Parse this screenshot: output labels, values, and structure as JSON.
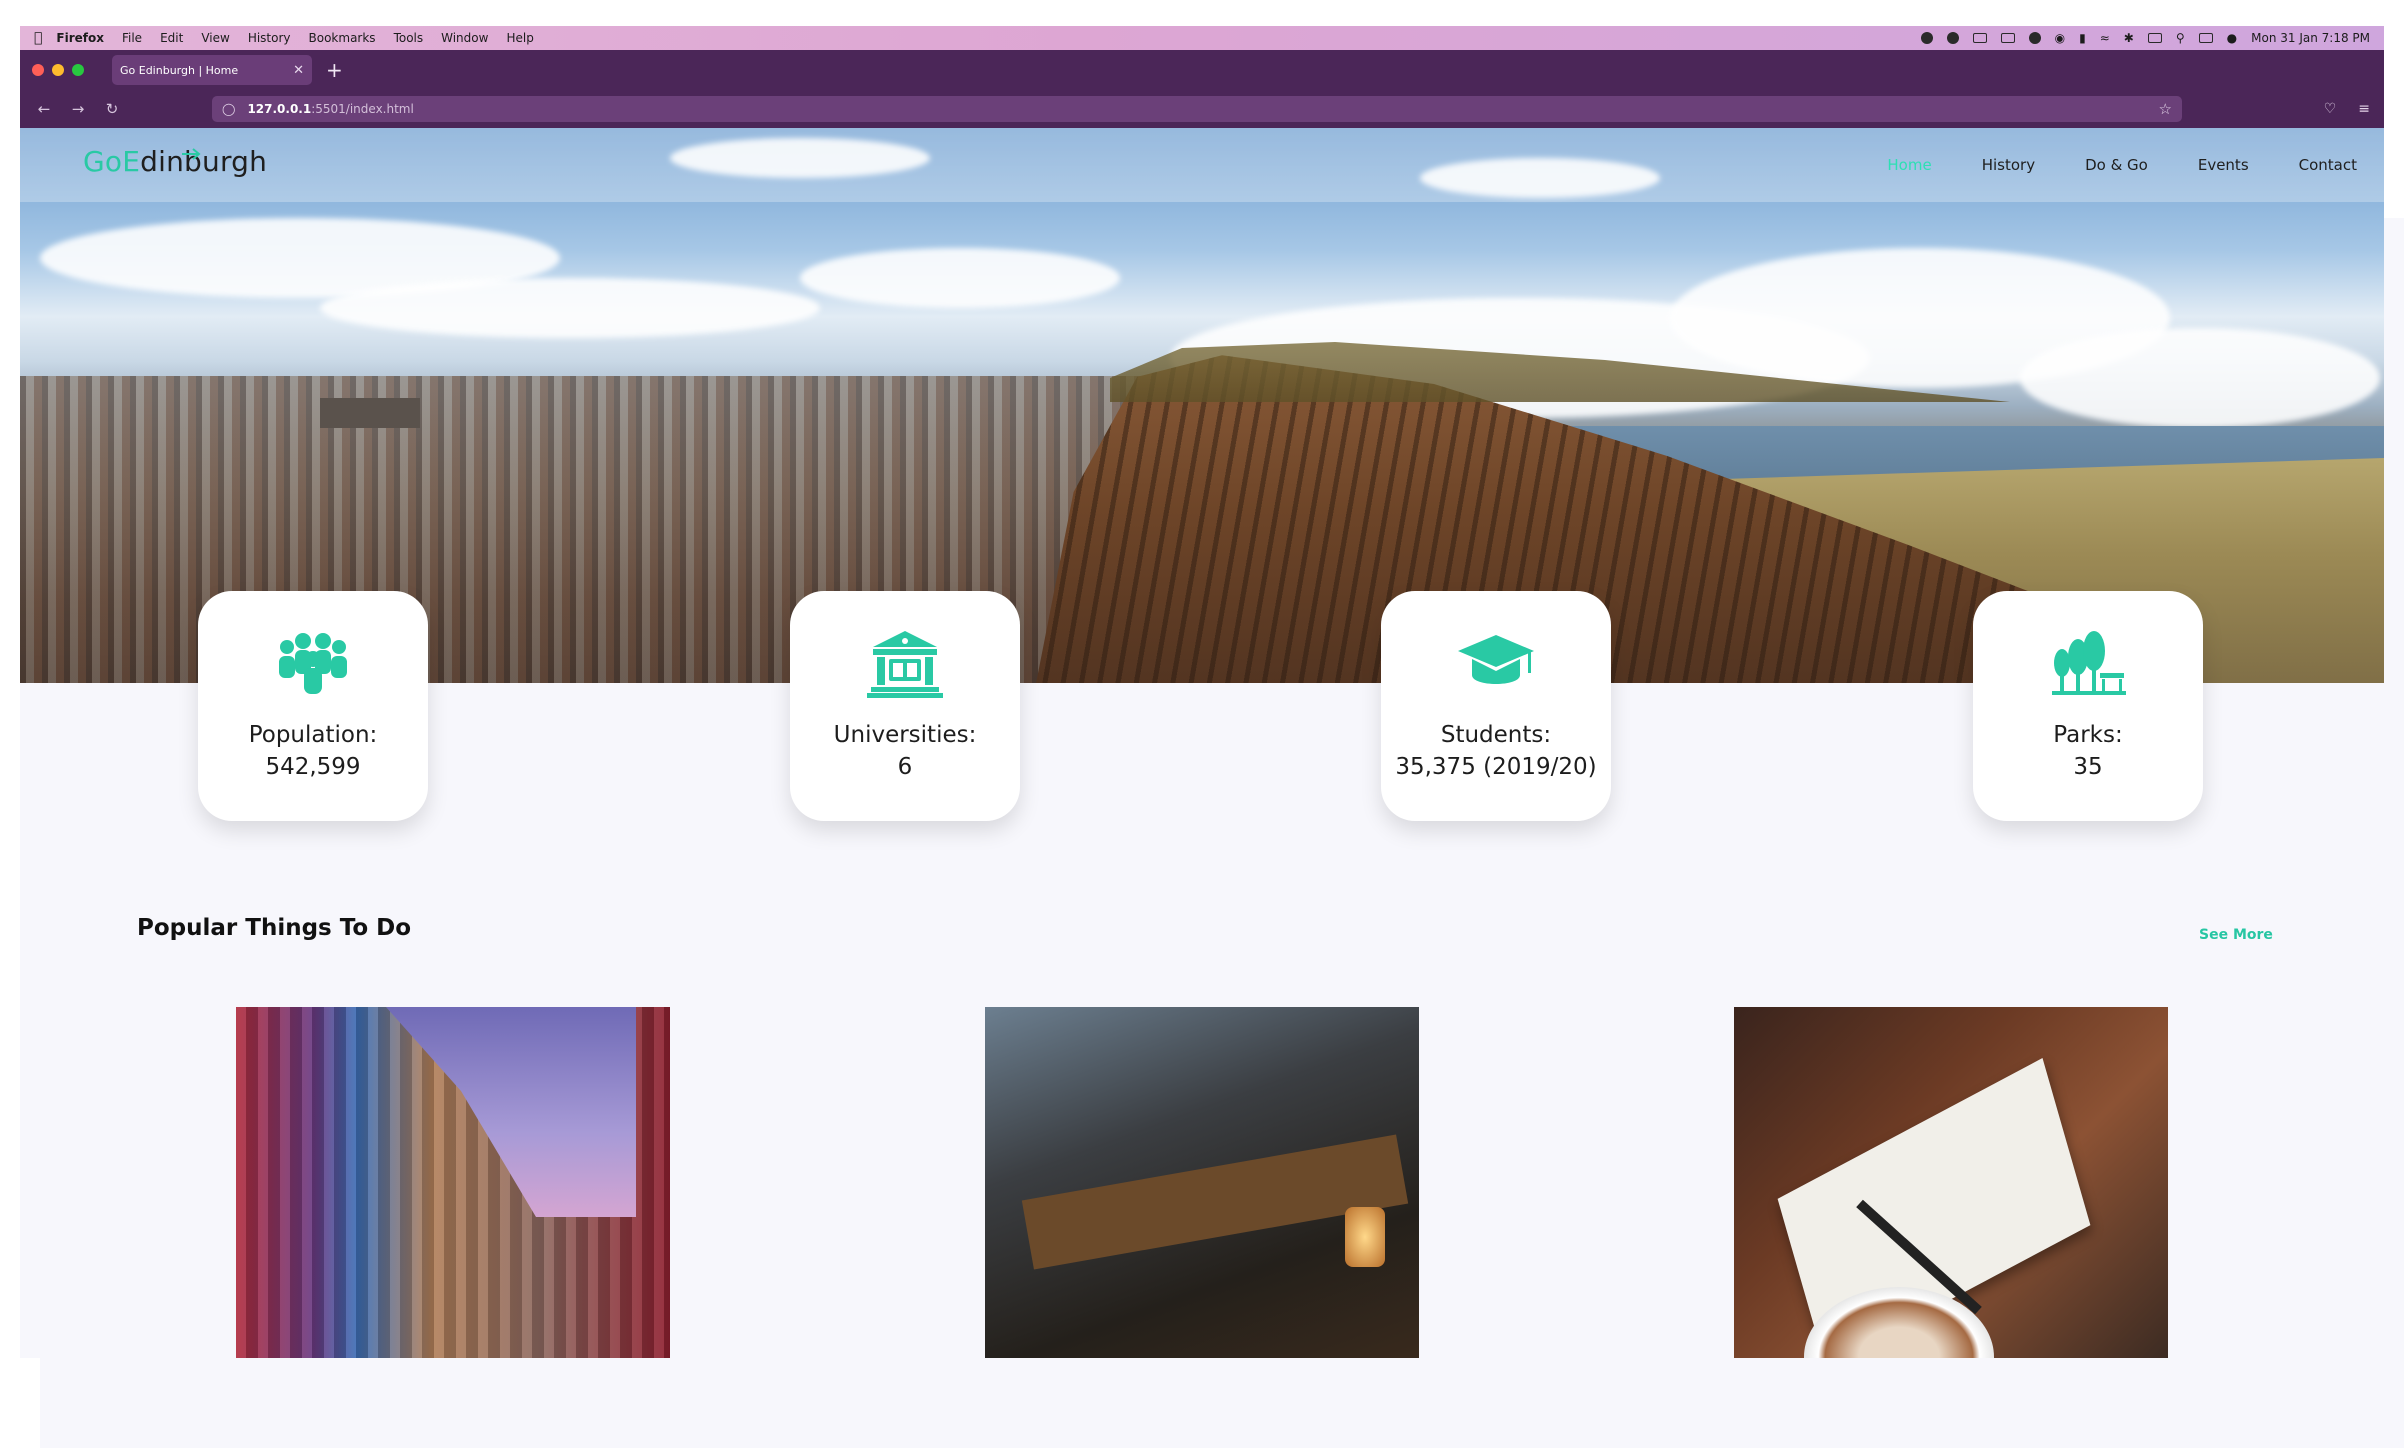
{
  "menubar": {
    "app": "Firefox",
    "items": [
      "File",
      "Edit",
      "View",
      "History",
      "Bookmarks",
      "Tools",
      "Window",
      "Help"
    ],
    "clock": "Mon 31 Jan  7:18 PM"
  },
  "browser": {
    "tab_title": "Go Edinburgh | Home",
    "url_host": "127.0.0.1",
    "url_path": ":5501/index.html"
  },
  "site": {
    "logo_prefix": "Go",
    "logo_accent": "E",
    "logo_suffix": "dinburgh",
    "nav": [
      {
        "label": "Home",
        "active": true
      },
      {
        "label": "History",
        "active": false
      },
      {
        "label": "Do & Go",
        "active": false
      },
      {
        "label": "Events",
        "active": false
      },
      {
        "label": "Contact",
        "active": false
      }
    ],
    "accent_color": "#29c9a4"
  },
  "stats": [
    {
      "icon": "people-group-icon",
      "label": "Population:",
      "value": "542,599"
    },
    {
      "icon": "university-building-icon",
      "label": "Universities:",
      "value": "6"
    },
    {
      "icon": "graduation-cap-icon",
      "label": "Students:",
      "value": "35,375 (2019/20)"
    },
    {
      "icon": "park-trees-icon",
      "label": "Parks:",
      "value": "35"
    }
  ],
  "popular": {
    "title": "Popular Things To Do",
    "see_more": "See More",
    "cards": [
      {
        "image": "colorful-street-photo"
      },
      {
        "image": "market-stall-photo"
      },
      {
        "image": "book-and-coffee-photo"
      }
    ]
  }
}
